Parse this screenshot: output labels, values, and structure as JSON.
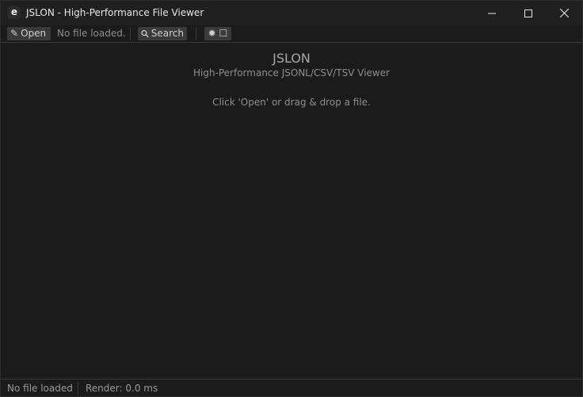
{
  "window": {
    "title": "JSLON - High-Performance File Viewer",
    "app_icon_letter": "e",
    "controls": {
      "minimize": "minimize-icon",
      "maximize": "maximize-icon",
      "close": "close-icon"
    }
  },
  "toolbar": {
    "open_icon": "✎",
    "open_label": "Open",
    "file_status": "No file loaded.",
    "search_icon": "🔍",
    "search_label": "Search",
    "theme_icon": "✹ ☐"
  },
  "main": {
    "app_name": "JSLON",
    "subtitle": "High-Performance JSONL/CSV/TSV Viewer",
    "hint": "Click 'Open' or drag & drop a file."
  },
  "statusbar": {
    "file_state": "No file loaded",
    "render_time": "Render: 0.0 ms"
  },
  "colors": {
    "background": "#1b1b1b",
    "titlebar": "#202020",
    "button": "#3a3a3a",
    "text": "#cfcfcf"
  }
}
